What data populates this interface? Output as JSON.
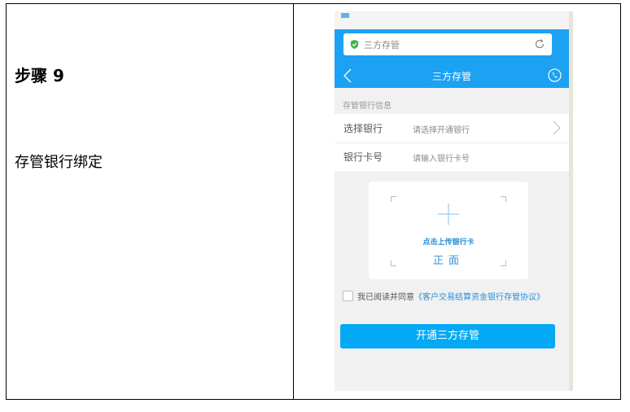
{
  "step": {
    "title": "步骤 9",
    "description": "存管银行绑定"
  },
  "phone": {
    "url_text": "三方存管",
    "nav_title": "三方存管",
    "section_label": "存管银行信息",
    "form": {
      "bank_label": "选择银行",
      "bank_placeholder": "请选择开通银行",
      "card_label": "银行卡号",
      "card_placeholder": "请输入银行卡号"
    },
    "upload": {
      "hint": "点击上传银行卡",
      "side": "正面"
    },
    "agreement": {
      "prefix": "我已阅读并同意",
      "link": "《客户交易结算资金银行存管协议》"
    },
    "open_button": "开通三方存管",
    "colors": {
      "primary": "#1da1f2",
      "button": "#03a9f4",
      "link": "#2a8fd6"
    }
  }
}
